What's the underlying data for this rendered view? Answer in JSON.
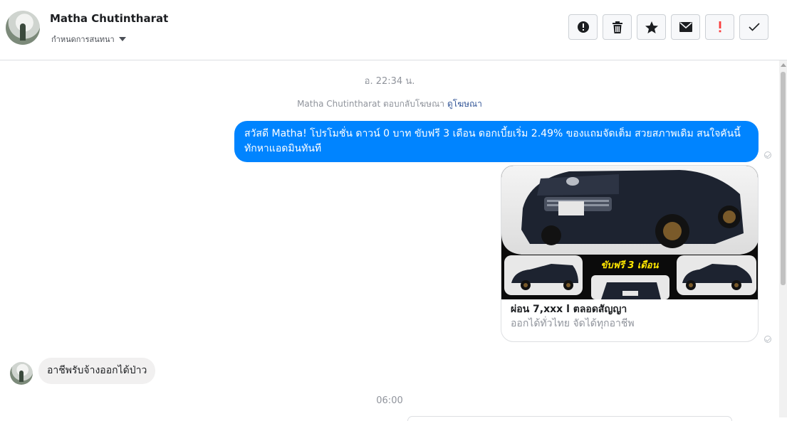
{
  "header": {
    "name": "Matha Chutintharat",
    "subtitle": "กำหนดการสนทนา",
    "actions": [
      {
        "icon": "exclamation-circle-icon"
      },
      {
        "icon": "trash-icon"
      },
      {
        "icon": "star-icon"
      },
      {
        "icon": "envelope-icon"
      },
      {
        "icon": "important-icon"
      },
      {
        "icon": "check-icon"
      }
    ]
  },
  "chat": {
    "timestamp_1": "อ. 22:34 น.",
    "reply_note": {
      "text": "Matha Chutintharat ตอบกลับโฆษณา",
      "link": "ดูโฆษณา"
    },
    "outgoing_message": "สวัสดี Matha! โปรโมชั่น ดาวน์ 0 บาท ขับฟรี 3 เดือน ดอกเบี้ยเริ่ม 2.49% ของแถมจัดเต็ม สวยสภาพเดิม สนใจคันนี้ทักหาแอดมินทันที",
    "card": {
      "banner_text": "ขับฟรี 3 เดือน",
      "title": "ผ่อน 7,xxx l ตลอดสัญญา",
      "subtitle": "ออกได้ทั่วไทย จัดได้ทุกอาชีพ"
    },
    "incoming_message": "อาชีพรับจ้างออกได้ป่าว",
    "timestamp_2": "06:00"
  },
  "colors": {
    "outgoing_bubble": "#0084ff",
    "incoming_bubble": "#f1f0f0",
    "link": "#365899",
    "important": "#fa3e3e"
  }
}
